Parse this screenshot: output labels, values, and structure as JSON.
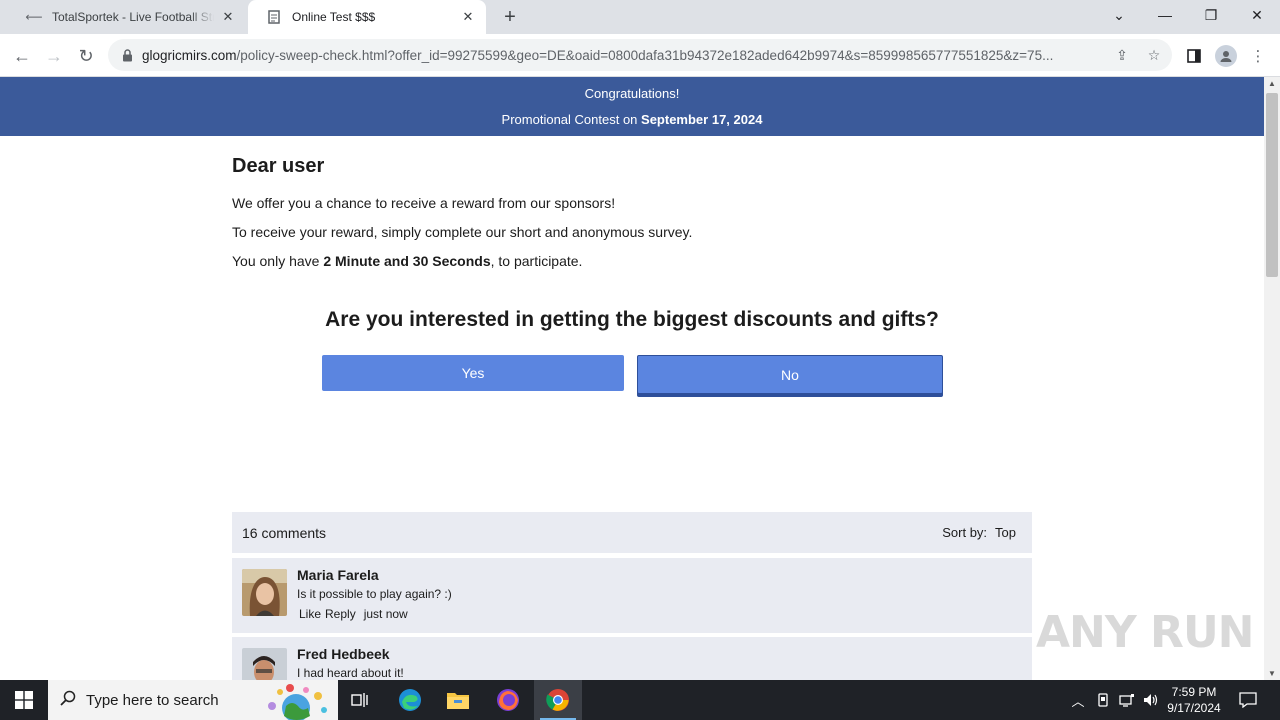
{
  "browser": {
    "tabs": [
      {
        "title": "TotalSportek - Live Football Streams",
        "active": false
      },
      {
        "title": "Online Test $$$",
        "active": true
      }
    ],
    "url_host": "glogricmirs.com",
    "url_path": "/policy-sweep-check.html?offer_id=99275599&geo=DE&oaid=0800dafa31b94372e182aded642b9974&s=859998565777551825&z=75..."
  },
  "banner": {
    "line1": "Congratulations!",
    "line2_prefix": "Promotional Contest on",
    "line2_date": "September 17, 2024"
  },
  "main": {
    "greeting": "Dear user",
    "para1": "We offer you a chance to receive a reward from our sponsors!",
    "para2": "To receive your reward, simply complete our short and anonymous survey.",
    "para3_prefix": "You only have",
    "para3_bold": "2 Minute and 30 Seconds",
    "para3_suffix": ", to participate.",
    "question": "Are you interested in getting the biggest discounts and gifts?",
    "yes_label": "Yes",
    "no_label": "No"
  },
  "comments": {
    "count_label": "16 comments",
    "sort_label": "Sort by:",
    "sort_value": "Top",
    "items": [
      {
        "name": "Maria Farela",
        "text": "Is it possible to play again? :)",
        "like": "Like",
        "reply": "Reply",
        "time": "just now"
      },
      {
        "name": "Fred Hedbeek",
        "text": "I had heard about it!"
      }
    ]
  },
  "watermark": "ANY RUN",
  "taskbar": {
    "search_placeholder": "Type here to search",
    "time": "7:59 PM",
    "date": "9/17/2024"
  },
  "colors": {
    "banner": "#3b5a9a",
    "button": "#5b85e0",
    "comment_bg": "#e9ebf2",
    "taskbar": "#1f2227"
  }
}
